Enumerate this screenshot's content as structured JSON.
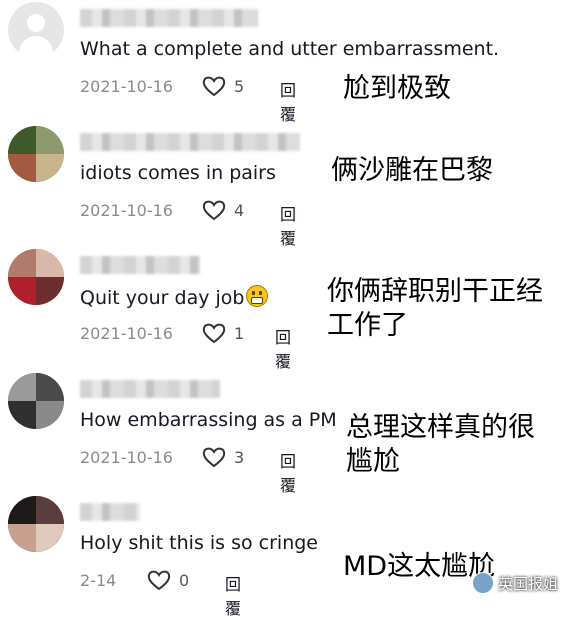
{
  "comments": [
    {
      "text": "What a complete and utter embarrassment.",
      "date": "2021-10-16",
      "likes": "5",
      "reply_label": "回覆",
      "annotation": [
        "尬到极致"
      ]
    },
    {
      "text": "idiots comes in pairs",
      "date": "2021-10-16",
      "likes": "4",
      "reply_label": "回覆",
      "annotation": [
        "俩沙雕在巴黎"
      ]
    },
    {
      "text": "Quit your day job",
      "date": "2021-10-16",
      "likes": "1",
      "reply_label": "回覆",
      "annotation": [
        "你俩辞职别干正经",
        "工作了"
      ]
    },
    {
      "text": "How embarrassing as a PM",
      "date": "2021-10-16",
      "likes": "3",
      "reply_label": "回覆",
      "annotation": [
        "总理这样真的很",
        "尴尬"
      ]
    },
    {
      "text": "Holy shit this is so cringe",
      "date": "2-14",
      "likes": "0",
      "reply_label": "回覆",
      "annotation": [
        "MD这太尴尬"
      ]
    }
  ],
  "watermark": "英国报姐",
  "icons": {
    "like": "heart-outline-icon",
    "emoji": "grimacing-face-emoji"
  }
}
